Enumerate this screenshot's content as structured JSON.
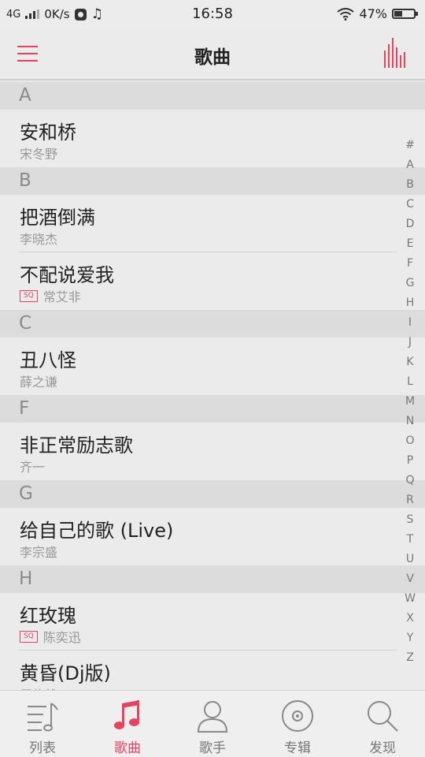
{
  "status_bar": {
    "network": "4G",
    "speed": "0K/s",
    "time": "16:58",
    "battery": "47%",
    "battery_level": 0.47
  },
  "header": {
    "title": "歌曲"
  },
  "sections": [
    {
      "letter": "A",
      "songs": [
        {
          "title": "安和桥",
          "artist": "宋冬野",
          "sq": false
        }
      ]
    },
    {
      "letter": "B",
      "songs": [
        {
          "title": "把酒倒满",
          "artist": "李晓杰",
          "sq": false
        },
        {
          "title": "不配说爱我",
          "artist": "常艾非",
          "sq": true
        }
      ]
    },
    {
      "letter": "C",
      "songs": [
        {
          "title": "丑八怪",
          "artist": "薛之谦",
          "sq": false
        }
      ]
    },
    {
      "letter": "F",
      "songs": [
        {
          "title": "非正常励志歌",
          "artist": "齐一",
          "sq": false
        }
      ]
    },
    {
      "letter": "G",
      "songs": [
        {
          "title": "给自己的歌 (Live)",
          "artist": "李宗盛",
          "sq": false
        }
      ]
    },
    {
      "letter": "H",
      "songs": [
        {
          "title": "红玫瑰",
          "artist": "陈奕迅",
          "sq": true
        },
        {
          "title": "黄昏(Dj版)",
          "artist": "周传雄",
          "sq": false
        }
      ]
    }
  ],
  "sq_label": "SQ",
  "alpha_index": [
    "#",
    "A",
    "B",
    "C",
    "D",
    "E",
    "F",
    "G",
    "H",
    "I",
    "J",
    "K",
    "L",
    "M",
    "N",
    "O",
    "P",
    "Q",
    "R",
    "S",
    "T",
    "U",
    "V",
    "W",
    "X",
    "Y",
    "Z"
  ],
  "tabs": [
    {
      "label": "列表",
      "icon": "list-music-icon",
      "active": false
    },
    {
      "label": "歌曲",
      "icon": "music-note-icon",
      "active": true
    },
    {
      "label": "歌手",
      "icon": "person-icon",
      "active": false
    },
    {
      "label": "专辑",
      "icon": "disc-icon",
      "active": false
    },
    {
      "label": "发现",
      "icon": "search-icon",
      "active": false
    }
  ],
  "colors": {
    "accent": "#e64360",
    "section_bg": "#dcdcdc",
    "background": "#ebebeb"
  }
}
